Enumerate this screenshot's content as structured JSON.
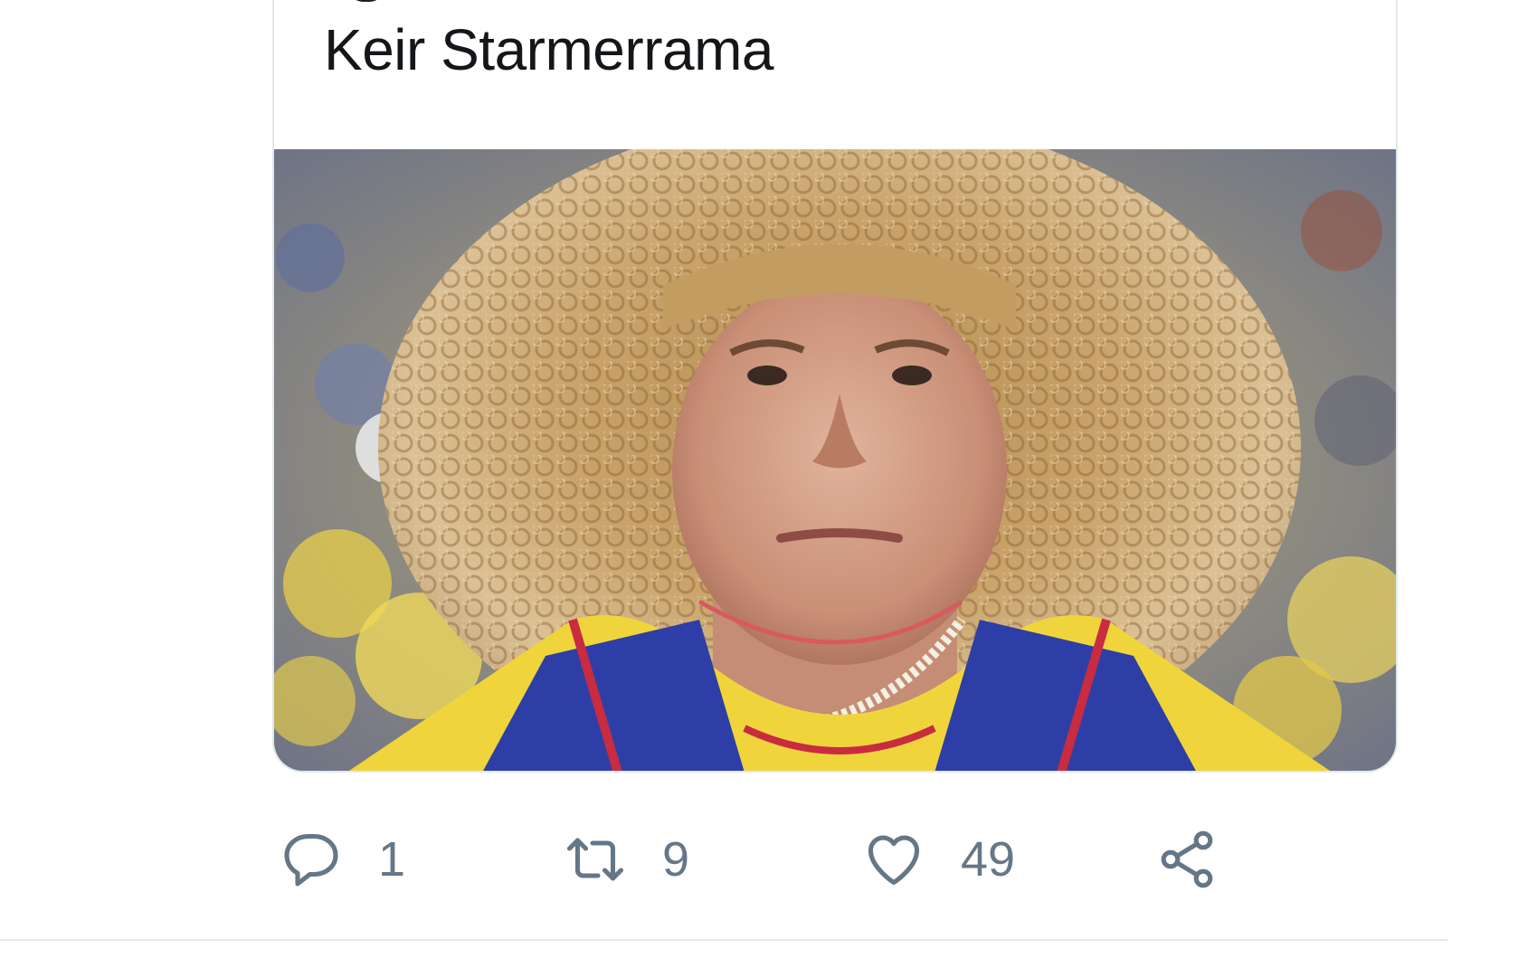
{
  "quoted_tweet": {
    "text": "Keir Starmerrama",
    "media_description_icon": "photo"
  },
  "actions": {
    "reply": {
      "icon": "reply-icon",
      "count": "1"
    },
    "retweet": {
      "icon": "retweet-icon",
      "count": "9"
    },
    "like": {
      "icon": "heart-icon",
      "count": "49"
    },
    "share": {
      "icon": "share-icon"
    }
  },
  "colors": {
    "text": "#14171a",
    "muted": "#657786",
    "border": "#e1e8ed"
  }
}
